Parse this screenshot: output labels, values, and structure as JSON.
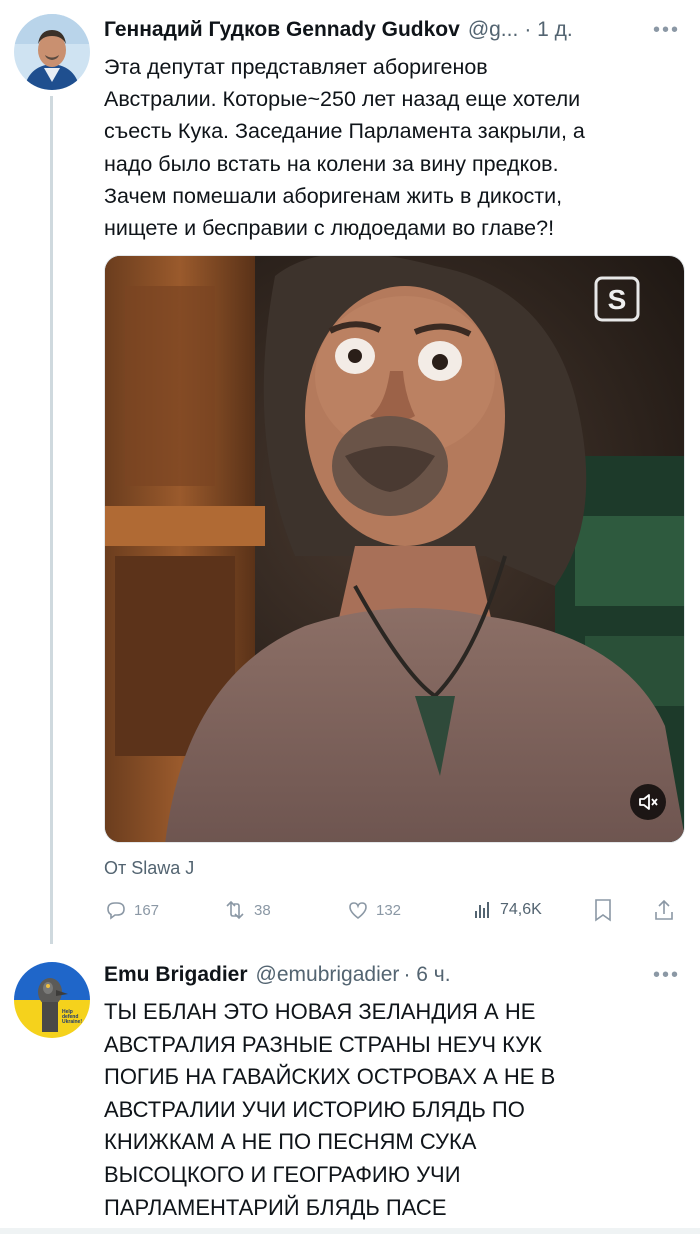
{
  "tweet1": {
    "name": "Геннадий Гудков Gennady Gudkov",
    "handle": "@g...",
    "time": "· 1 д.",
    "text_lines": [
      "Эта депутат представляет аборигенов",
      "Австралии. Которые~250 лет назад еще хотели",
      "съесть Кука. Заседание Парламента закрыли, а",
      "надо  было встать на колени за вину предков.",
      "Зачем помешали аборигенам жить в дикости,",
      "нищете и бесправии с людоедами во главе?!"
    ],
    "media": {
      "watermark": "S",
      "mute_icon": "mute-icon"
    },
    "from_label": "От Slawa J",
    "actions": {
      "reply_count": "167",
      "retweet_count": "38",
      "like_count": "132",
      "views_count": "74,6K"
    }
  },
  "tweet2": {
    "name": "Emu Brigadier",
    "handle": "@emubrigadier",
    "time": "· 6 ч.",
    "text_lines": [
      "ТЫ ЕБЛАН ЭТО НОВАЯ ЗЕЛАНДИЯ А НЕ",
      "АВСТРАЛИЯ РАЗНЫЕ СТРАНЫ НЕУЧ КУК",
      "ПОГИБ НА ГАВАЙСКИХ ОСТРОВАХ А НЕ В",
      "АВСТРАЛИИ УЧИ ИСТОРИЮ БЛЯДЬ ПО",
      "КНИЖКАМ А НЕ ПО ПЕСНЯМ СУКА",
      "ВЫСОЦКОГО И ГЕОГРАФИЮ УЧИ",
      "ПАРЛАМЕНТАРИЙ БЛЯДЬ ПАСЕ"
    ],
    "avatar_caption": "Help defend Ukraine!"
  },
  "colors": {
    "text": "#0f1419",
    "secondary": "#536471",
    "divider": "#cfd9de",
    "ukraine_blue": "#1f66c9",
    "ukraine_yellow": "#f5d21c"
  }
}
